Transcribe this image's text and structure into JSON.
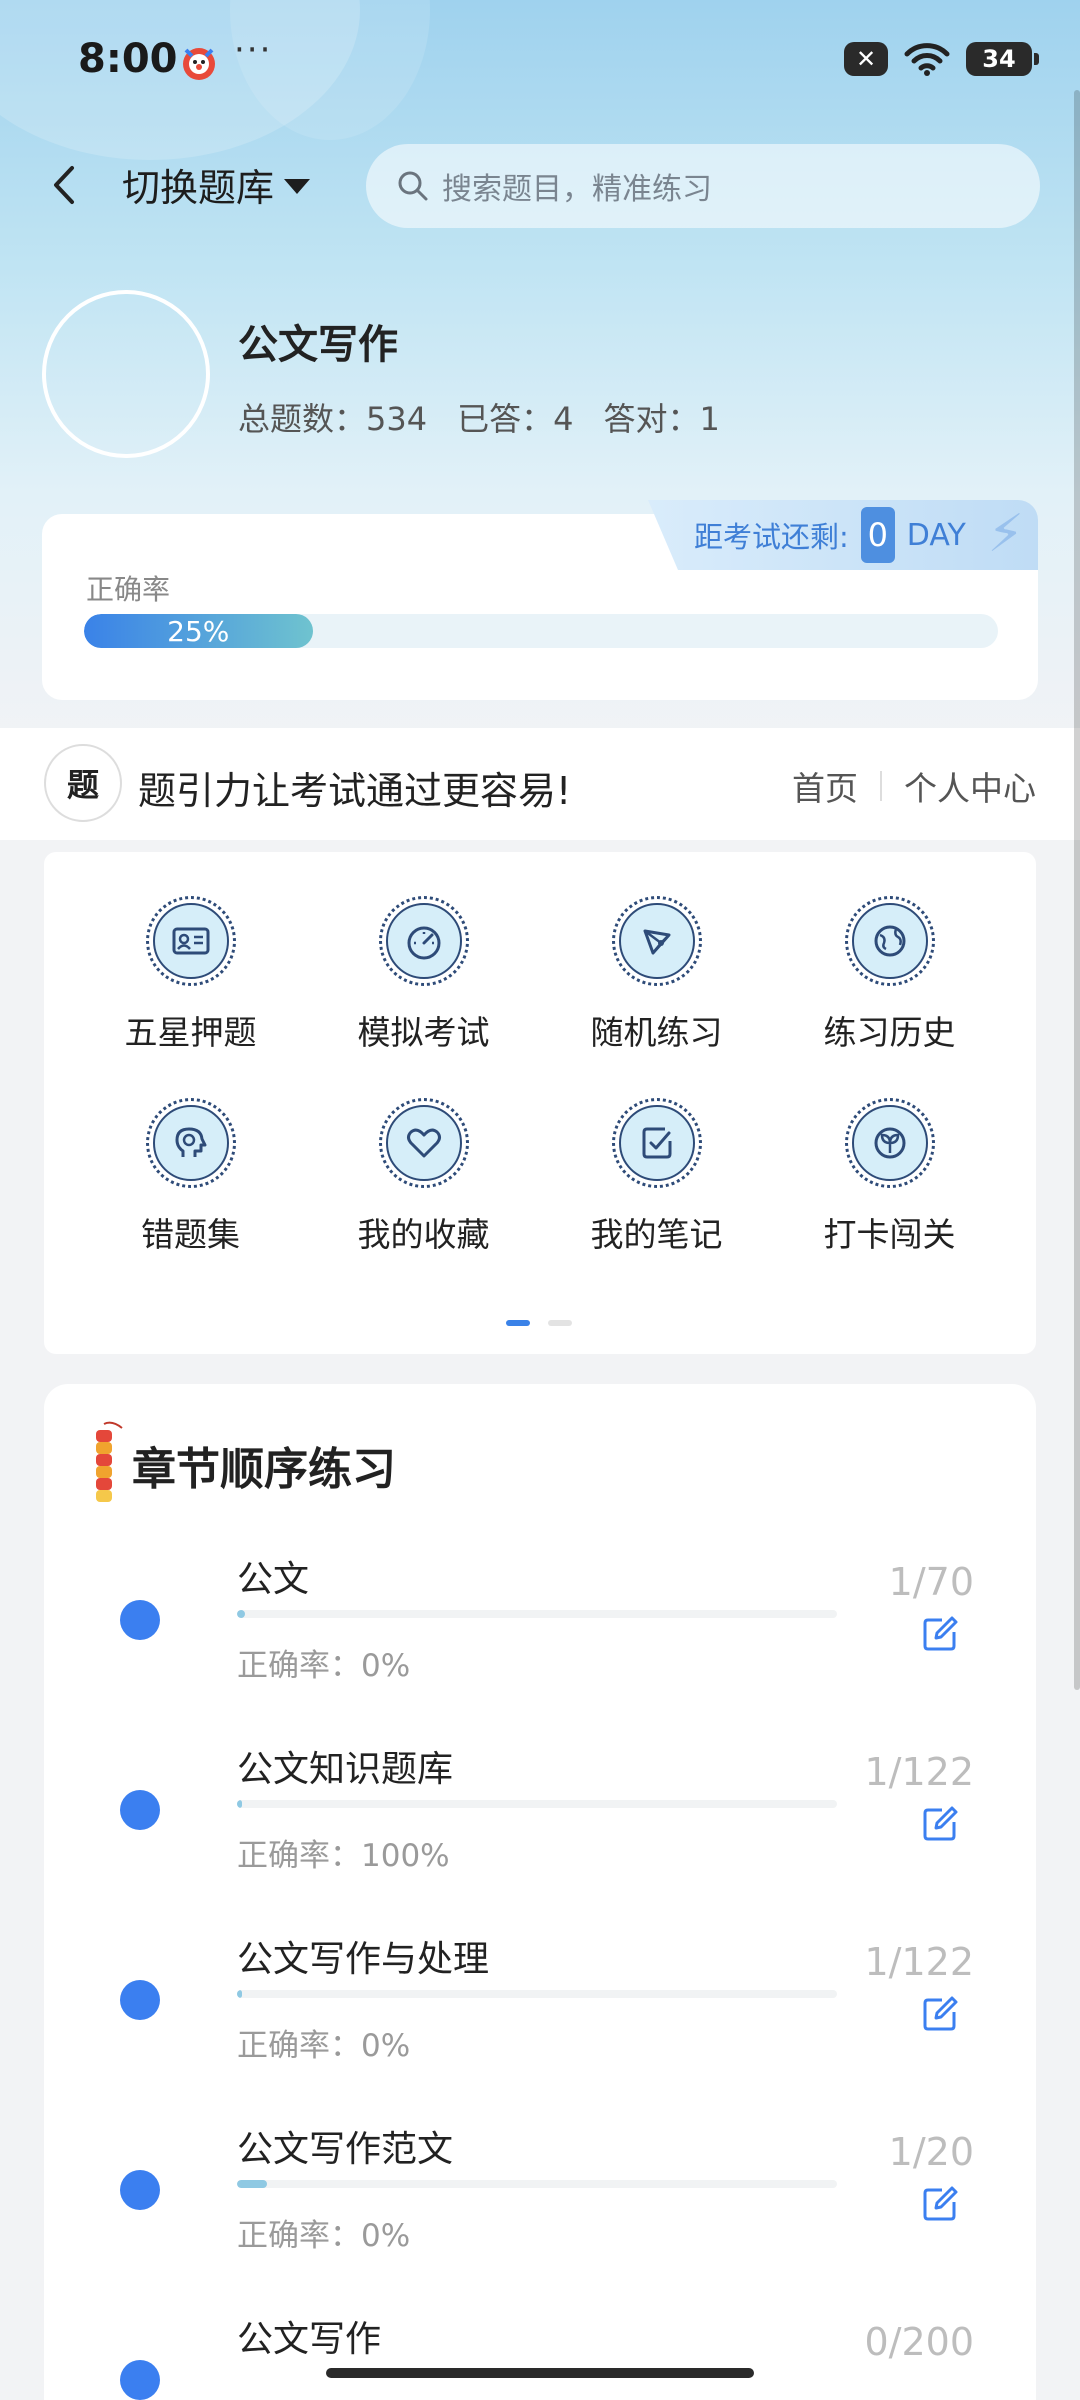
{
  "status_bar": {
    "time": "8:00",
    "more": "···",
    "battery": "34",
    "sim": "✕",
    "icons": [
      "app-clown-icon",
      "sim-disabled-icon",
      "wifi-icon",
      "battery-icon"
    ]
  },
  "topbar": {
    "switch_label": "切换题库",
    "search_placeholder": "搜索题目，精准练习"
  },
  "profile": {
    "name": "公文写作",
    "total_label": "总题数：",
    "total": "534",
    "answered_label": "已答：",
    "answered": "4",
    "correct_label": "答对：",
    "correct": "1"
  },
  "accuracy": {
    "label": "正确率",
    "percent_text": "25%",
    "percent": 0.25,
    "exam_label": "距考试还剩:",
    "exam_days": "0",
    "exam_unit": "DAY"
  },
  "slogan": {
    "logo": "题",
    "text": "题引力让考试通过更容易!",
    "home": "首页",
    "center": "个人中心"
  },
  "menu": [
    {
      "label": "五星押题",
      "icon": "id-card-icon"
    },
    {
      "label": "模拟考试",
      "icon": "speedometer-icon"
    },
    {
      "label": "随机练习",
      "icon": "network-icon"
    },
    {
      "label": "练习历史",
      "icon": "globe-icon"
    },
    {
      "label": "错题集",
      "icon": "brain-icon"
    },
    {
      "label": "我的收藏",
      "icon": "heart-icon"
    },
    {
      "label": "我的笔记",
      "icon": "note-check-icon"
    },
    {
      "label": "打卡闯关",
      "icon": "sprout-icon"
    }
  ],
  "chapter": {
    "title": "章节顺序练习",
    "acc_prefix": "正确率：",
    "items": [
      {
        "name": "公文",
        "count": "1/70",
        "accuracy": "0%",
        "progress": 0.014
      },
      {
        "name": "公文知识题库",
        "count": "1/122",
        "accuracy": "100%",
        "progress": 0.008
      },
      {
        "name": "公文写作与处理",
        "count": "1/122",
        "accuracy": "0%",
        "progress": 0.008
      },
      {
        "name": "公文写作范文",
        "count": "1/20",
        "accuracy": "0%",
        "progress": 0.05
      },
      {
        "name": "公文写作",
        "count": "0/200",
        "accuracy": "",
        "progress": 0
      }
    ]
  }
}
